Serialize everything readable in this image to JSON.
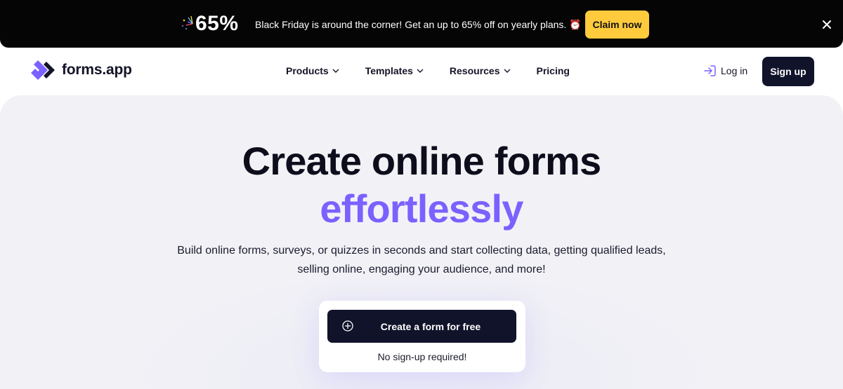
{
  "promo": {
    "percent": "65%",
    "message": "Black Friday is around the corner! Get an up to 65% off on yearly plans. ⏰",
    "claim_label": "Claim now",
    "close_icon": "close-icon",
    "claim_color": "#ffcb3d"
  },
  "nav": {
    "logo_text": "forms.app",
    "menu": [
      {
        "label": "Products",
        "has_dropdown": true
      },
      {
        "label": "Templates",
        "has_dropdown": true
      },
      {
        "label": "Resources",
        "has_dropdown": true
      },
      {
        "label": "Pricing",
        "has_dropdown": false
      }
    ],
    "login_label": "Log in",
    "signup_label": "Sign up",
    "brand_color": "#7b61ff"
  },
  "hero": {
    "title_line1": "Create online forms",
    "title_line2": "effortlessly",
    "subtitle": "Build online forms, surveys, or quizzes in seconds and start collecting data, getting qualified leads, selling online, engaging your audience, and more!",
    "cta_label": "Create a form for free",
    "cta_note": "No sign-up required!",
    "accent_color": "#7b61ff"
  }
}
